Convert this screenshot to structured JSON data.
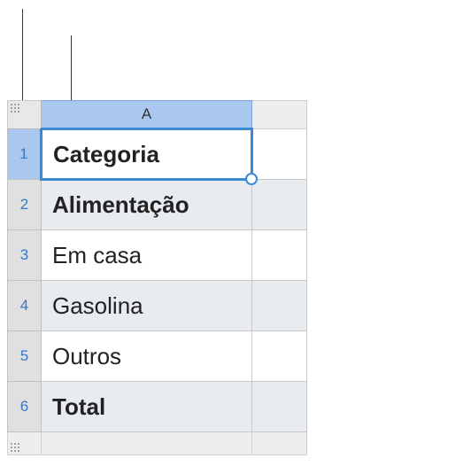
{
  "columns": {
    "A": "A"
  },
  "rows": {
    "r1": "1",
    "r2": "2",
    "r3": "3",
    "r4": "4",
    "r5": "5",
    "r6": "6"
  },
  "cells": {
    "a1": "Categoria",
    "a2": "Alimentação",
    "a3": "Em casa",
    "a4": "Gasolina",
    "a5": "Outros",
    "a6": "Total"
  }
}
